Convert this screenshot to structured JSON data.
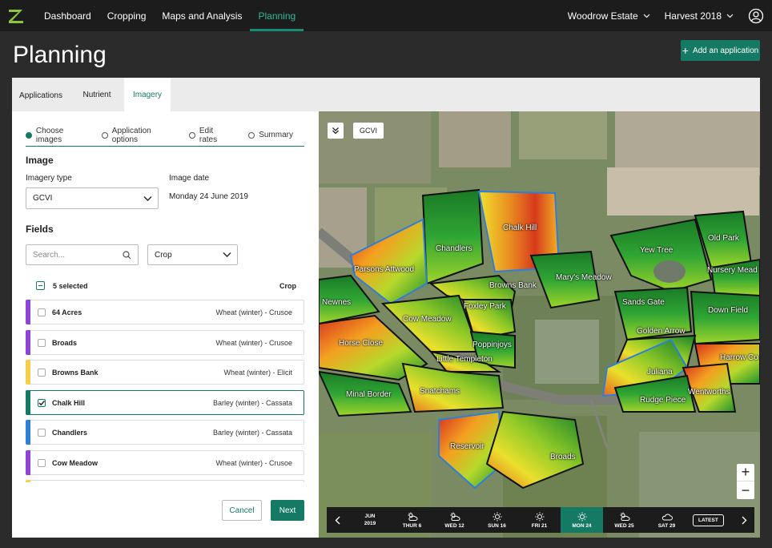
{
  "nav": {
    "items": [
      "Dashboard",
      "Cropping",
      "Maps and Analysis",
      "Planning"
    ],
    "active": "Planning",
    "estate": "Woodrow Estate",
    "harvest": "Harvest 2018"
  },
  "header": {
    "title": "Planning",
    "add_label": "Add an application"
  },
  "tabs": [
    "Applications",
    "Nutrient",
    "Imagery"
  ],
  "steps": [
    "Choose images",
    "Application options",
    "Edit rates",
    "Summary"
  ],
  "image": {
    "heading": "Image",
    "type_label": "Imagery type",
    "type_value": "GCVI",
    "date_label": "Image date",
    "date_value": "Monday 24 June 2019"
  },
  "fields": {
    "heading": "Fields",
    "search_placeholder": "Search...",
    "crop_filter": "Crop",
    "selected_text": "5 selected",
    "crop_header": "Crop",
    "rows": [
      {
        "name": "64 Acres",
        "crop": "Wheat (winter) - Crusoe",
        "color": "#8e44d6",
        "checked": false
      },
      {
        "name": "Broads",
        "crop": "Wheat (winter) - Crusoe",
        "color": "#8e44d6",
        "checked": false
      },
      {
        "name": "Browns Bank",
        "crop": "Wheat (winter) - Elicit",
        "color": "#f5cf4a",
        "checked": false
      },
      {
        "name": "Chalk Hill",
        "crop": "Barley (winter) - Cassata",
        "color": "#157a64",
        "checked": true
      },
      {
        "name": "Chandlers",
        "crop": "Barley (winter) - Cassata",
        "color": "#2f7fd8",
        "checked": false
      },
      {
        "name": "Cow Meadow",
        "crop": "Wheat (winter) - Crusoe",
        "color": "#8e44d6",
        "checked": false
      }
    ]
  },
  "buttons": {
    "cancel": "Cancel",
    "next": "Next"
  },
  "map": {
    "chip": "GCVI",
    "labels": [
      "Chalk Hill",
      "Chandlers",
      "Parsons Attwood",
      "Browns Bank",
      "Mary's Meadow",
      "Newnes",
      "Foxley Park",
      "Cow Meadow",
      "Horse Close",
      "Poppinjoys",
      "Little Templeton",
      "Minal Border",
      "Snatchams",
      "Reservoir",
      "Broads",
      "Old Park",
      "Yew Tree",
      "Nursery Mead",
      "Sands Gate",
      "Down Field",
      "Golden Arrow",
      "Harrow Co",
      "Juliana",
      "Wentworths",
      "Rudge Piece"
    ]
  },
  "timeline": {
    "month": "JUN",
    "year": "2019",
    "days": [
      {
        "label": "THUR 6",
        "icon": "cloud-sun-icon",
        "active": false
      },
      {
        "label": "WED 12",
        "icon": "cloud-sun-icon",
        "active": false
      },
      {
        "label": "SUN 16",
        "icon": "sun-icon",
        "active": false
      },
      {
        "label": "FRI 21",
        "icon": "sun-icon",
        "active": false
      },
      {
        "label": "MON 24",
        "icon": "sun-icon",
        "active": true
      },
      {
        "label": "WED 25",
        "icon": "cloud-sun-icon",
        "active": false
      },
      {
        "label": "SAT 29",
        "icon": "cloud-icon",
        "active": false
      }
    ],
    "latest": "LATEST"
  },
  "colors": {
    "accent": "#157a64",
    "nav_bg": "#1c1c1c"
  }
}
